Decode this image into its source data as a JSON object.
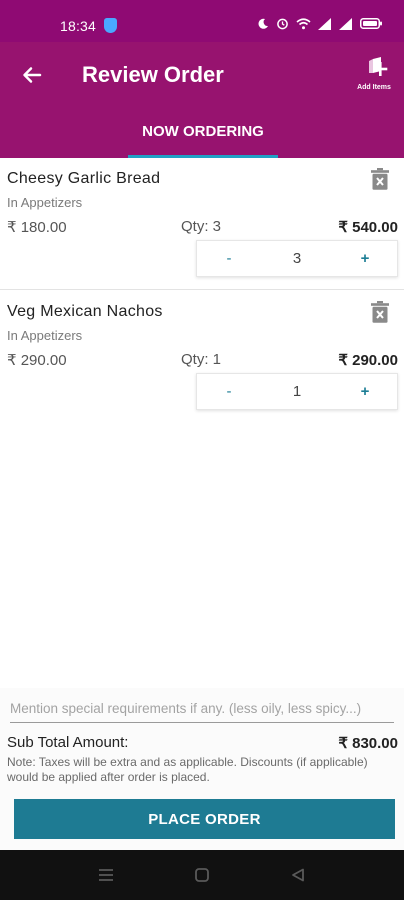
{
  "status_bar": {
    "time": "18:34",
    "icons": [
      "moon-icon",
      "alarm-icon",
      "wifi-icon",
      "signal-icon",
      "signal-icon",
      "battery-icon"
    ]
  },
  "header": {
    "title": "Review Order",
    "add_items_label": "Add Items",
    "tab_label": "NOW ORDERING"
  },
  "items": [
    {
      "name": "Cheesy Garlic Bread",
      "category": "In Appetizers",
      "price": "₹ 180.00",
      "qty_label": "Qty: 3",
      "total": "₹ 540.00",
      "stepper": {
        "minus": "-",
        "value": "3",
        "plus": "+"
      }
    },
    {
      "name": "Veg Mexican Nachos",
      "category": "In Appetizers",
      "price": "₹ 290.00",
      "qty_label": "Qty: 1",
      "total": "₹ 290.00",
      "stepper": {
        "minus": "-",
        "value": "1",
        "plus": "+"
      }
    }
  ],
  "footer": {
    "special_requirements_placeholder": "Mention special requirements if any. (less oily, less spicy...)",
    "subtotal_label": "Sub Total Amount:",
    "subtotal_value": "₹ 830.00",
    "tax_note": "Note: Taxes will be extra and as applicable. Discounts (if applicable) would be applied after order is placed.",
    "place_order_label": "PLACE ORDER"
  },
  "colors": {
    "header": "#97136f",
    "status_bar": "#8f0a73",
    "tab_indicator": "#1fa2c4",
    "accent": "#1e7b93",
    "nav_bar": "#111111"
  }
}
